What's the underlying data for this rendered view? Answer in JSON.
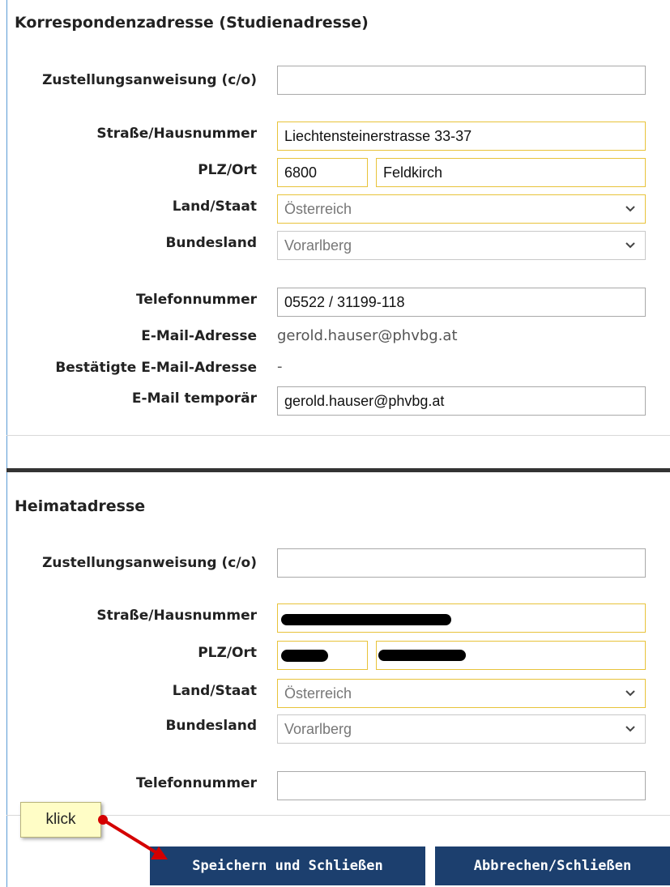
{
  "korrespondenz": {
    "title": "Korrespondenzadresse (Studienadresse)",
    "co_label": "Zustellungsanweisung (c/o)",
    "co_value": "",
    "street_label": "Straße/Hausnummer",
    "street_value": "Liechtensteinerstrasse 33-37",
    "plz_label": "PLZ/Ort",
    "plz_value": "6800",
    "ort_value": "Feldkirch",
    "land_label": "Land/Staat",
    "land_value": "Österreich",
    "bundesland_label": "Bundesland",
    "bundesland_value": "Vorarlberg",
    "tel_label": "Telefonnummer",
    "tel_value": "05522 / 31199-118",
    "email_label": "E-Mail-Adresse",
    "email_value": "gerold.hauser@phvbg.at",
    "email_confirmed_label": "Bestätigte E-Mail-Adresse",
    "email_confirmed_value": "-",
    "email_temp_label": "E-Mail temporär",
    "email_temp_value": "gerold.hauser@phvbg.at"
  },
  "heimat": {
    "title": "Heimatadresse",
    "co_label": "Zustellungsanweisung (c/o)",
    "co_value": "",
    "street_label": "Straße/Hausnummer",
    "plz_label": "PLZ/Ort",
    "land_label": "Land/Staat",
    "land_value": "Österreich",
    "bundesland_label": "Bundesland",
    "bundesland_value": "Vorarlberg",
    "tel_label": "Telefonnummer",
    "tel_value": ""
  },
  "annotation": {
    "note_text": "klick"
  },
  "buttons": {
    "save_label": "Speichern und Schließen",
    "cancel_label": "Abbrechen/Schließen"
  },
  "colors": {
    "accent_yellow": "#e8c33a",
    "button_navy": "#1c3f6e",
    "frame_blue": "#5b9bd5",
    "arrow_red": "#d40000",
    "note_bg": "#fffdc6"
  },
  "icons": [
    "chevron-down-icon",
    "red-arrow-icon"
  ]
}
